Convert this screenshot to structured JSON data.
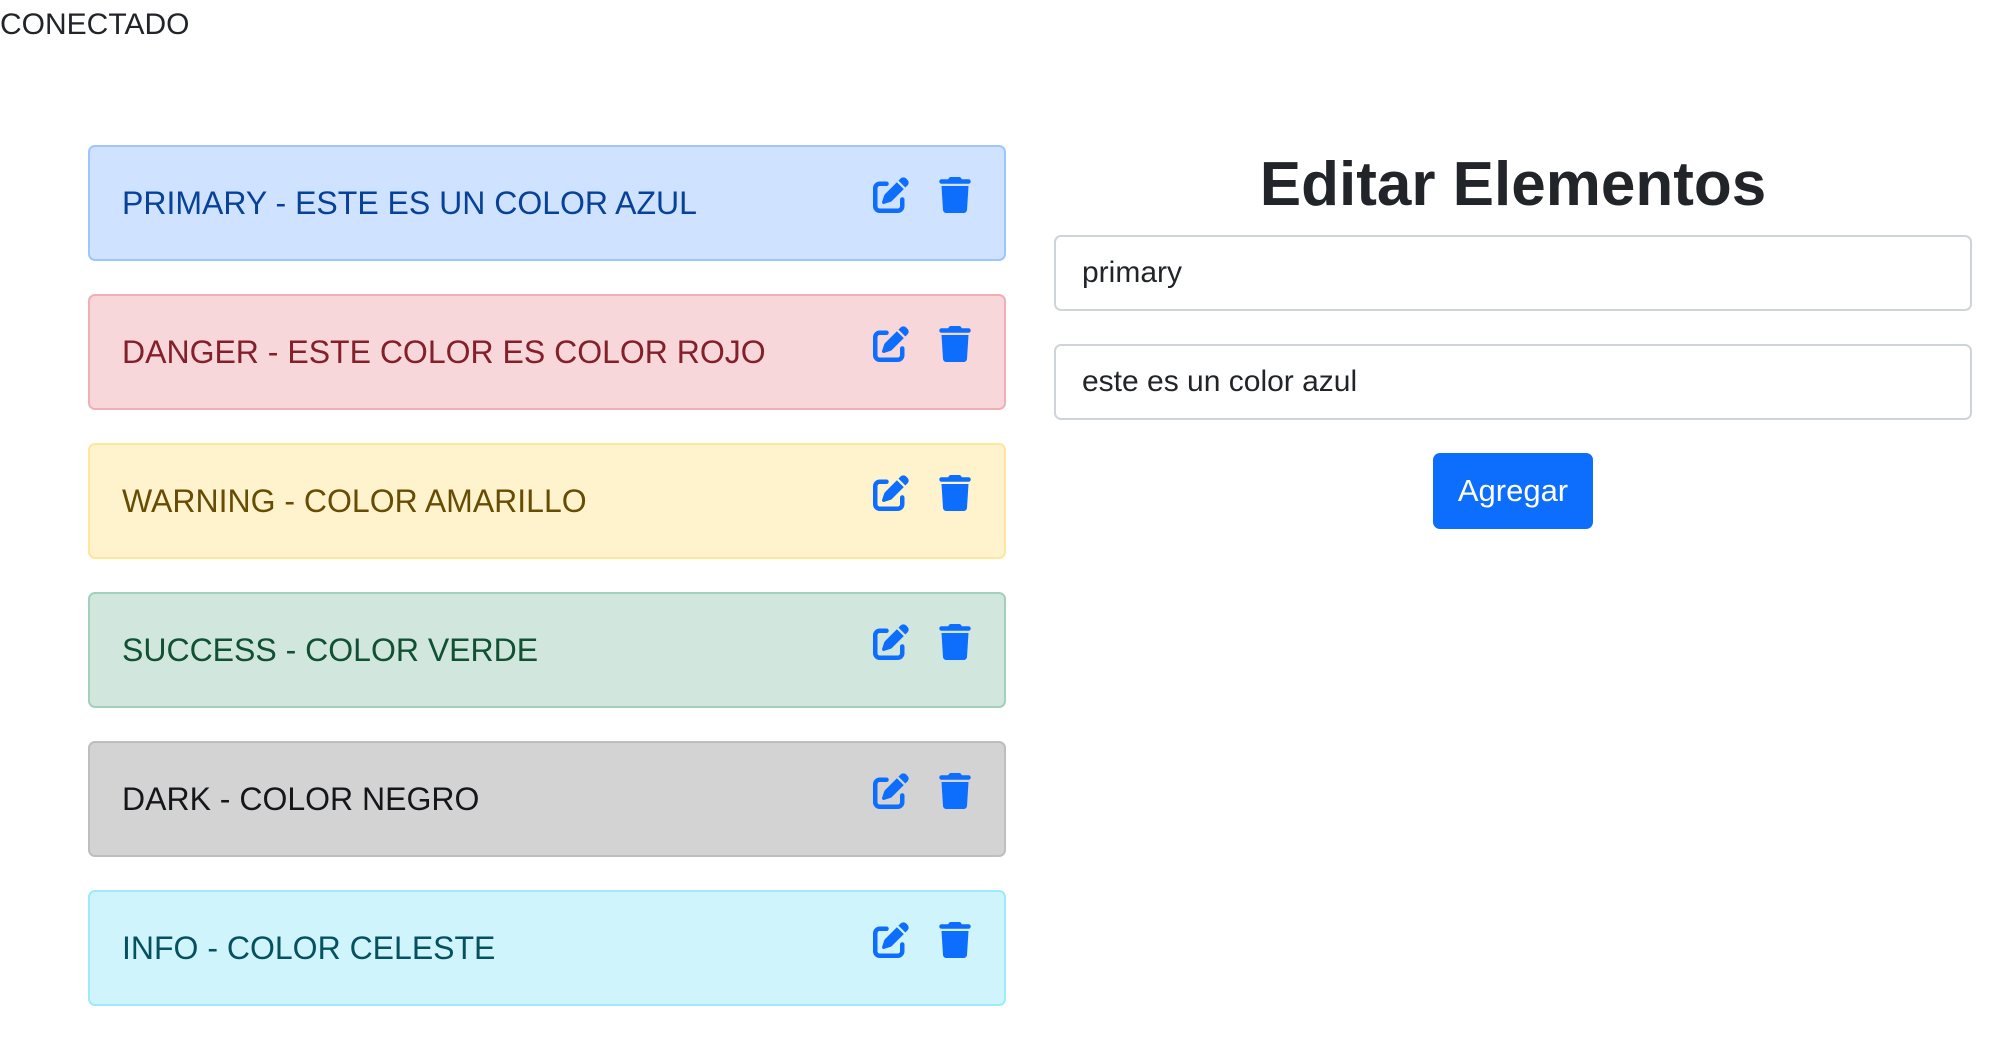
{
  "status": {
    "text": "CONECTADO"
  },
  "colors": {
    "icon": "#0d6efd",
    "button": "#0d6efd"
  },
  "list": {
    "items": [
      {
        "variant": "primary",
        "text": "primary - este es un color azul",
        "bg": "#cfe2ff",
        "border": "#9ec5fe",
        "color": "#084298",
        "edit_icon": "pen-to-square-icon",
        "delete_icon": "trash-icon"
      },
      {
        "variant": "danger",
        "text": "danger - este color es color rojo",
        "bg": "#f8d7da",
        "border": "#f1aeb5",
        "color": "#842029",
        "edit_icon": "pen-to-square-icon",
        "delete_icon": "trash-icon"
      },
      {
        "variant": "warning",
        "text": "warning - color amarillo",
        "bg": "#fff3cd",
        "border": "#ffe69c",
        "color": "#664d03",
        "edit_icon": "pen-to-square-icon",
        "delete_icon": "trash-icon"
      },
      {
        "variant": "success",
        "text": "success - color verde",
        "bg": "#d1e7dd",
        "border": "#a3cfbb",
        "color": "#0f5132",
        "edit_icon": "pen-to-square-icon",
        "delete_icon": "trash-icon"
      },
      {
        "variant": "dark",
        "text": "dark - color negro",
        "bg": "#d3d3d4",
        "border": "#bcbebf",
        "color": "#141619",
        "edit_icon": "pen-to-square-icon",
        "delete_icon": "trash-icon"
      },
      {
        "variant": "info",
        "text": "info - color celeste",
        "bg": "#cff4fc",
        "border": "#9eeaf9",
        "color": "#055160",
        "edit_icon": "pen-to-square-icon",
        "delete_icon": "trash-icon"
      }
    ]
  },
  "form": {
    "title": "Editar Elementos",
    "variant_value": "primary",
    "description_value": "este es un color azul",
    "submit_label": "Agregar"
  }
}
